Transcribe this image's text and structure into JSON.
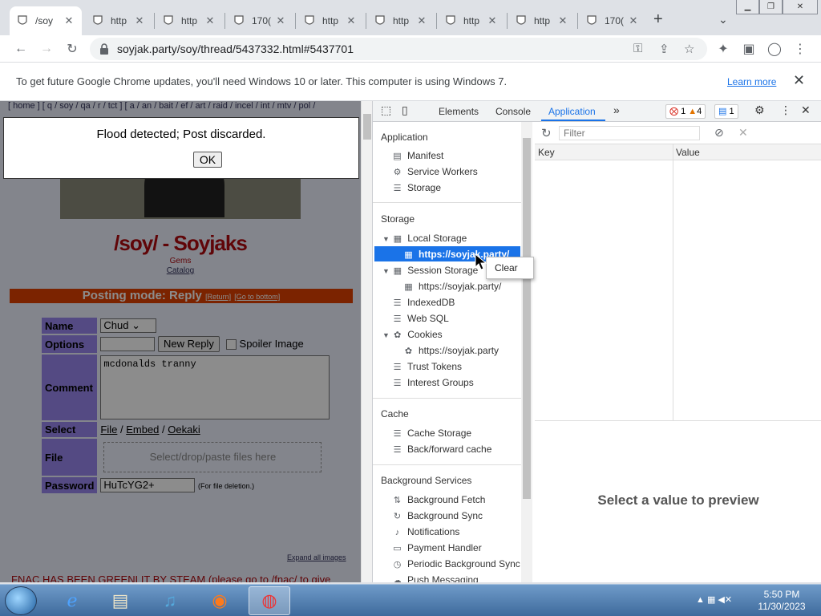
{
  "tabs": [
    {
      "title": "/soy",
      "active": true
    },
    {
      "title": "http"
    },
    {
      "title": "http"
    },
    {
      "title": "170("
    },
    {
      "title": "http"
    },
    {
      "title": "http"
    },
    {
      "title": "http"
    },
    {
      "title": "http"
    },
    {
      "title": "170("
    }
  ],
  "toolbar": {
    "url": "soyjak.party/soy/thread/5437332.html#5437701"
  },
  "infobar": {
    "message": "To get future Google Chrome updates, you'll need Windows 10 or later. This computer is using Windows 7.",
    "learn_more": "Learn more"
  },
  "webpage": {
    "nav": "[ home ] [ q / soy / qa / r / tct ] [ a / an / bait / ef / art / raid / incel / int / mtv / pol /",
    "board_title": "/soy/ - Soyjaks",
    "gems": "Gems",
    "catalog": "Catalog",
    "posting_mode": "Posting mode: Reply",
    "return_link": "[Return]",
    "bottom_link": "[Go to bottom]",
    "form": {
      "name_label": "Name",
      "name_value": "Chud",
      "options_label": "Options",
      "new_reply": "New Reply",
      "spoiler": "Spoiler Image",
      "comment_label": "Comment",
      "comment_value": "mcdonalds tranny",
      "select_label": "Select",
      "select_file": "File",
      "select_embed": "Embed",
      "select_oekaki": "Oekaki",
      "file_label": "File",
      "file_drop": "Select/drop/paste files here",
      "password_label": "Password",
      "password_value": "HuTcYG2+",
      "password_note": "(For file deletion.)"
    },
    "expand_images": "Expand all images",
    "bottom_text": "FNAC HAS BEEN GREENLIT BY STEAM (please go to /fnac/ to give"
  },
  "alert": {
    "message": "Flood detected; Post discarded.",
    "ok": "OK"
  },
  "devtools": {
    "tabs": [
      "Elements",
      "Console",
      "Application"
    ],
    "selected_tab": "Application",
    "errors": "1",
    "warnings": "4",
    "messages": "1",
    "sidebar": {
      "application_header": "Application",
      "application_items": [
        "Manifest",
        "Service Workers",
        "Storage"
      ],
      "storage_header": "Storage",
      "local_storage": "Local Storage",
      "local_storage_child": "https://soyjak.party/",
      "session_storage": "Session Storage",
      "session_storage_child": "https://soyjak.party/",
      "indexeddb": "IndexedDB",
      "websql": "Web SQL",
      "cookies": "Cookies",
      "cookies_child": "https://soyjak.party",
      "trust_tokens": "Trust Tokens",
      "interest_groups": "Interest Groups",
      "cache_header": "Cache",
      "cache_items": [
        "Cache Storage",
        "Back/forward cache"
      ],
      "bg_header": "Background Services",
      "bg_items": [
        "Background Fetch",
        "Background Sync",
        "Notifications",
        "Payment Handler",
        "Periodic Background Sync",
        "Push Messaging"
      ]
    },
    "filter_placeholder": "Filter",
    "col_key": "Key",
    "col_value": "Value",
    "preview": "Select a value to preview",
    "context_menu": "Clear"
  },
  "taskbar": {
    "time": "5:50 PM",
    "date": "11/30/2023"
  }
}
